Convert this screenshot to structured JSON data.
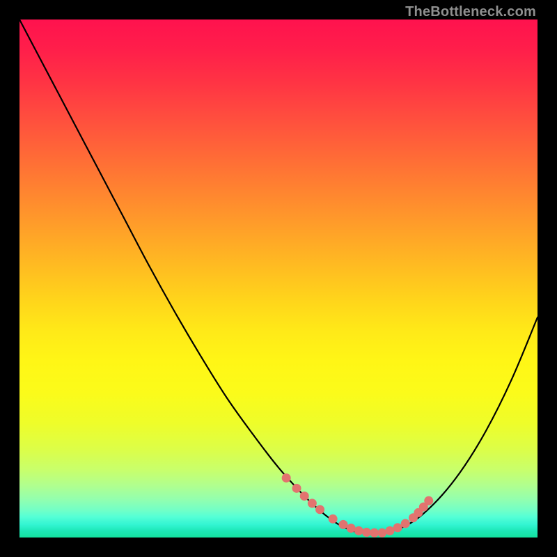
{
  "watermark": "TheBottleneck.com",
  "chart_data": {
    "type": "line",
    "title": "",
    "xlabel": "",
    "ylabel": "",
    "xlim": [
      0,
      100
    ],
    "ylim": [
      0,
      100
    ],
    "grid": false,
    "legend": false,
    "annotations": [],
    "series": [
      {
        "name": "curve",
        "x": [
          0,
          5,
          10,
          15,
          20,
          25,
          30,
          35,
          40,
          45,
          50,
          55,
          58,
          60,
          62,
          64,
          66,
          70,
          75,
          80,
          85,
          90,
          95,
          100
        ],
        "values": [
          100,
          90.5,
          81,
          71.5,
          62,
          52.5,
          43.5,
          35,
          27,
          20,
          13.5,
          8,
          5.2,
          3.6,
          2.3,
          1.4,
          0.9,
          0.9,
          2.5,
          6.5,
          12.5,
          20.5,
          30.5,
          42.5
        ]
      },
      {
        "name": "dots",
        "x": [
          51.5,
          53.5,
          55.0,
          56.5,
          58.0,
          60.5,
          62.5,
          64.0,
          65.5,
          67.0,
          68.5,
          70.0,
          71.5,
          73.0,
          74.5,
          76.0,
          77.0,
          78.0,
          79.0
        ],
        "values": [
          11.5,
          9.5,
          8.0,
          6.6,
          5.4,
          3.6,
          2.5,
          1.8,
          1.3,
          1.0,
          0.9,
          0.9,
          1.3,
          1.9,
          2.7,
          3.8,
          4.8,
          5.9,
          7.1
        ]
      }
    ],
    "background_gradient": {
      "top": "#ff124e",
      "mid": "#ffe918",
      "bottom": "#14e29f"
    }
  }
}
